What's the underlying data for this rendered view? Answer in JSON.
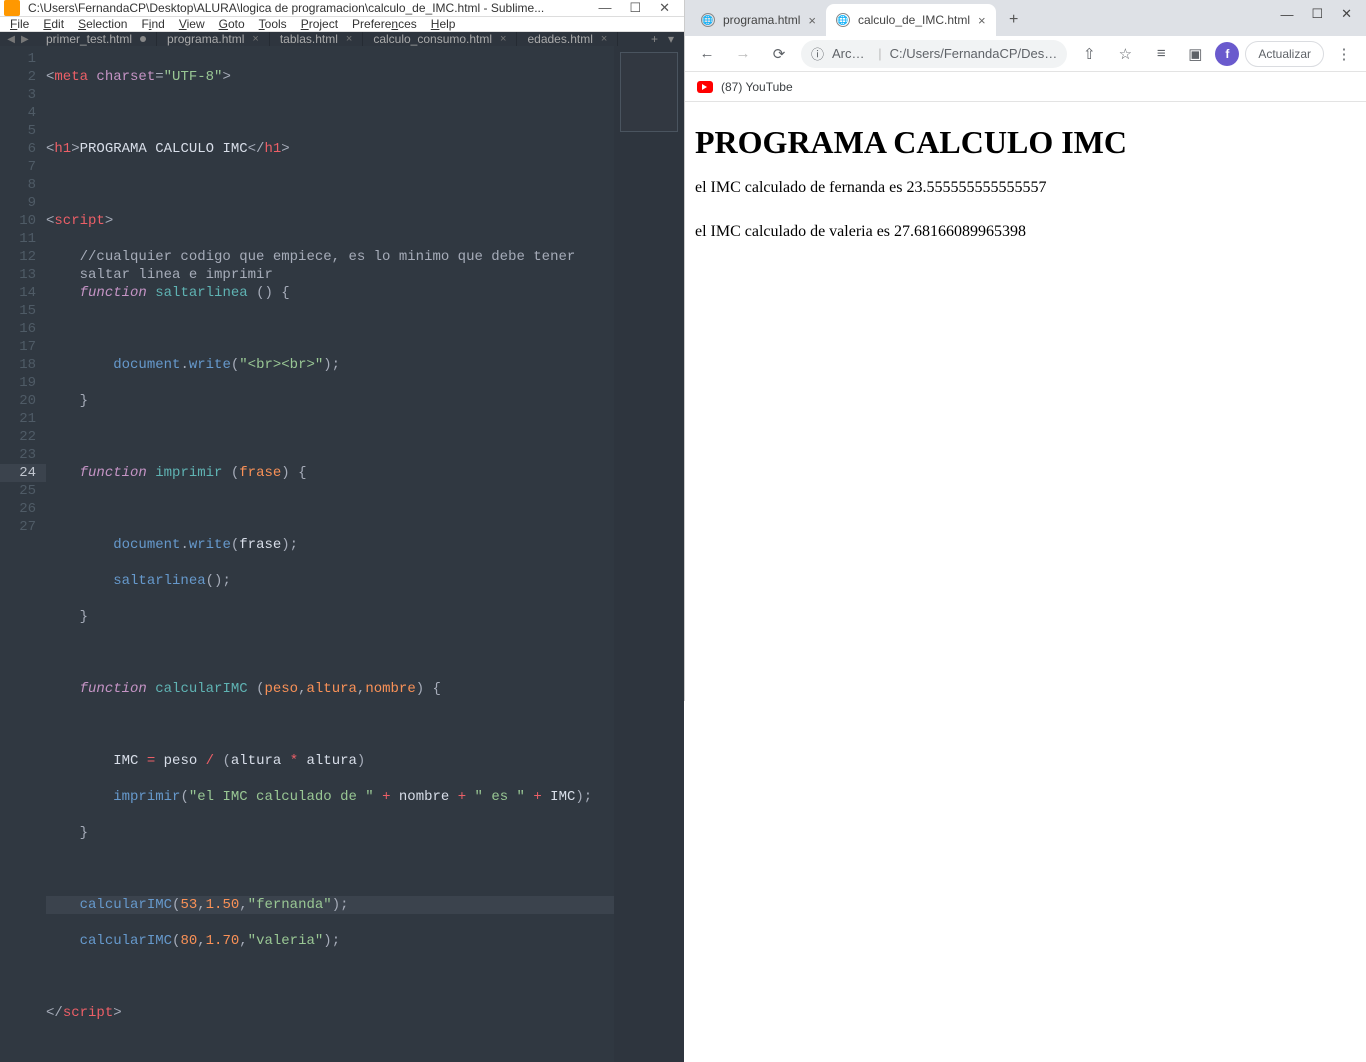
{
  "sublime": {
    "title": "C:\\Users\\FernandaCP\\Desktop\\ALURA\\logica de programacion\\calculo_de_IMC.html - Sublime...",
    "win_min": "—",
    "win_max": "☐",
    "win_close": "✕",
    "menu": {
      "file": "File",
      "edit": "Edit",
      "selection": "Selection",
      "find": "Find",
      "view": "View",
      "goto": "Goto",
      "tools": "Tools",
      "project": "Project",
      "preferences": "Preferences",
      "help": "Help"
    },
    "tabs": [
      {
        "label": "primer_test.html",
        "dirty": true
      },
      {
        "label": "programa.html",
        "dirty": false
      },
      {
        "label": "tablas.html",
        "dirty": false
      },
      {
        "label": "calculo_consumo.html",
        "dirty": false
      },
      {
        "label": "edades.html",
        "dirty": false
      }
    ],
    "tab_add": "+",
    "tab_menu": "▾",
    "tab_nav_left": "◀",
    "tab_nav_right": "▶"
  },
  "chrome": {
    "tabs": [
      {
        "label": "programa.html",
        "active": false
      },
      {
        "label": "calculo_de_IMC.html",
        "active": true
      }
    ],
    "newtab": "+",
    "win_min": "—",
    "win_max": "☐",
    "win_close": "✕",
    "nav_back": "←",
    "nav_fwd": "→",
    "nav_reload": "⟳",
    "url_scheme_label": "Archivo",
    "url_path": "C:/Users/FernandaCP/Desktop...",
    "info_icon": "ⓘ",
    "share_icon": "⇧",
    "star_icon": "☆",
    "reader_icon": "≡",
    "panel_icon": "▣",
    "avatar_letter": "f",
    "update_label": "Actualizar",
    "menu_icon": "⋮",
    "bookmark_label": "(87) YouTube"
  },
  "page": {
    "heading": "PROGRAMA CALCULO IMC",
    "line1": "el IMC calculado de fernanda es 23.555555555555557",
    "line2": "el IMC calculado de valeria es 27.68166089965398"
  }
}
